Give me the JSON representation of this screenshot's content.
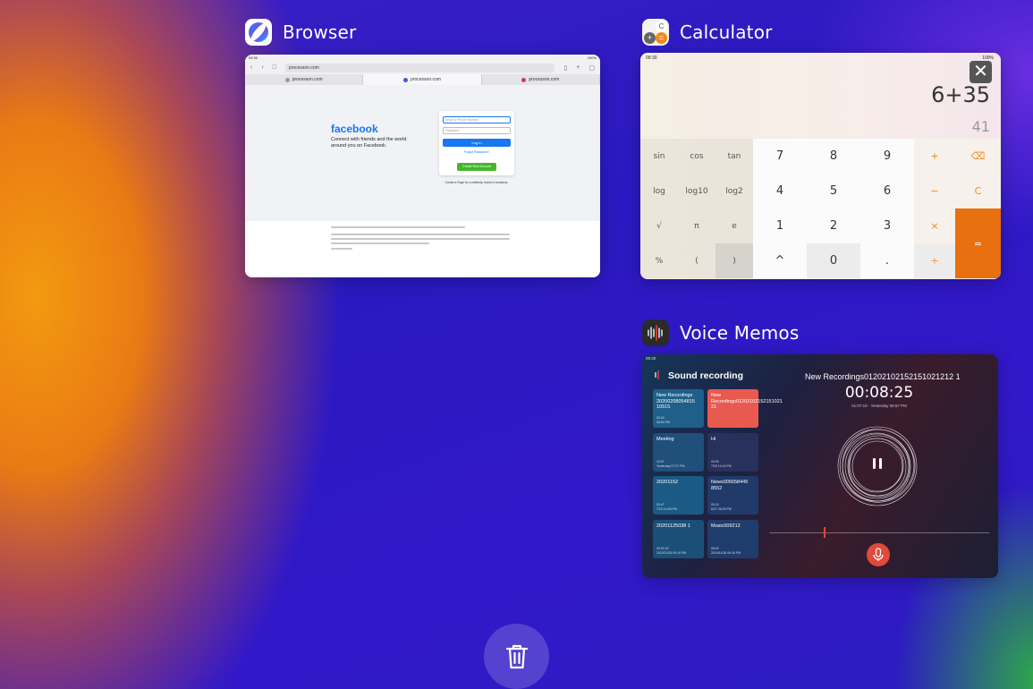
{
  "apps": {
    "browser": {
      "title": "Browser",
      "status_time": "09:30",
      "status_battery": "100%",
      "url": "processon.com",
      "tabs": [
        {
          "label": "processon.com"
        },
        {
          "label": "processon.com"
        },
        {
          "label": "processon.com"
        }
      ],
      "page": {
        "logo": "facebook",
        "tagline": "Connect with friends and the world around you on Facebook.",
        "email_placeholder": "Email or Phone Number",
        "password_placeholder": "Password",
        "login_label": "Log In",
        "forgot_label": "Forgot Password?",
        "create_label": "Create New Account",
        "page_note": "Create a Page for a celebrity, brand or business."
      }
    },
    "calculator": {
      "title": "Calculator",
      "status_time": "09:30",
      "status_battery": "100%",
      "close_label": "✕",
      "expression": "6+35",
      "result": "41",
      "keys": [
        {
          "label": "sin",
          "kind": "sci"
        },
        {
          "label": "cos",
          "kind": "sci"
        },
        {
          "label": "tan",
          "kind": "sci"
        },
        {
          "label": "7",
          "kind": "num"
        },
        {
          "label": "8",
          "kind": "num"
        },
        {
          "label": "9",
          "kind": "num"
        },
        {
          "label": "+",
          "kind": "op"
        },
        {
          "label": "⌫",
          "kind": "op"
        },
        {
          "label": "log",
          "kind": "sci"
        },
        {
          "label": "log10",
          "kind": "sci"
        },
        {
          "label": "log2",
          "kind": "sci"
        },
        {
          "label": "4",
          "kind": "num"
        },
        {
          "label": "5",
          "kind": "num"
        },
        {
          "label": "6",
          "kind": "num"
        },
        {
          "label": "−",
          "kind": "op"
        },
        {
          "label": "C",
          "kind": "op"
        },
        {
          "label": "√",
          "kind": "sci"
        },
        {
          "label": "π",
          "kind": "sci"
        },
        {
          "label": "e",
          "kind": "sci"
        },
        {
          "label": "1",
          "kind": "num"
        },
        {
          "label": "2",
          "kind": "num"
        },
        {
          "label": "3",
          "kind": "num"
        },
        {
          "label": "×",
          "kind": "op"
        },
        {
          "label": "=",
          "kind": "eq"
        },
        {
          "label": "%",
          "kind": "sci"
        },
        {
          "label": "(",
          "kind": "sci"
        },
        {
          "label": ")",
          "kind": "sci-dark"
        },
        {
          "label": "^",
          "kind": "num"
        },
        {
          "label": "0",
          "kind": "num-alt"
        },
        {
          "label": ".",
          "kind": "num"
        },
        {
          "label": "÷",
          "kind": "op-alt"
        }
      ]
    },
    "voice_memos": {
      "title": "Voice Memos",
      "status_time": "09:30",
      "header": "Sound recording",
      "recordings": [
        {
          "name": "New Recordings 20200208054815 10515",
          "duration": "00:42",
          "date": "08:54 PM",
          "color": "#1f5f8a"
        },
        {
          "name": "New Recordings01202102152151021 21",
          "duration": "",
          "date": "",
          "color": "#e85a50"
        },
        {
          "name": "Meeting",
          "duration": "10:07",
          "date": "Yesterday 07:27 PM",
          "color": "#1f4f7a"
        },
        {
          "name": "Hi",
          "duration": "00:09",
          "date": "7/25 10:15 PM",
          "color": "#28305c"
        },
        {
          "name": "20201152",
          "duration": "00:47",
          "date": "7/15 10:45 PM",
          "color": "#1a5a84"
        },
        {
          "name": "News005658445 8552",
          "duration": "00:10",
          "date": "6/27 06:30 PM",
          "color": "#203a6a"
        },
        {
          "name": "20201125038 1",
          "duration": "00:02:42",
          "date": "2019/11/26 09:10 PM",
          "color": "#1b4f78"
        },
        {
          "name": "Music009212",
          "duration": "06:02",
          "date": "2019/11/26 09:10 PM",
          "color": "#1f3d6c"
        }
      ],
      "current_title": "New Recordings01202102152151021212 1",
      "timer": "00:08:25",
      "current_date": "01:07:19 · Yesterday 08:57 PM"
    }
  },
  "trash_icon": "trash-icon",
  "colors": {
    "calc_accent": "#e8700e",
    "fb_blue": "#1877f2",
    "fb_green": "#42b72a",
    "rec_red": "#e04a3a"
  }
}
